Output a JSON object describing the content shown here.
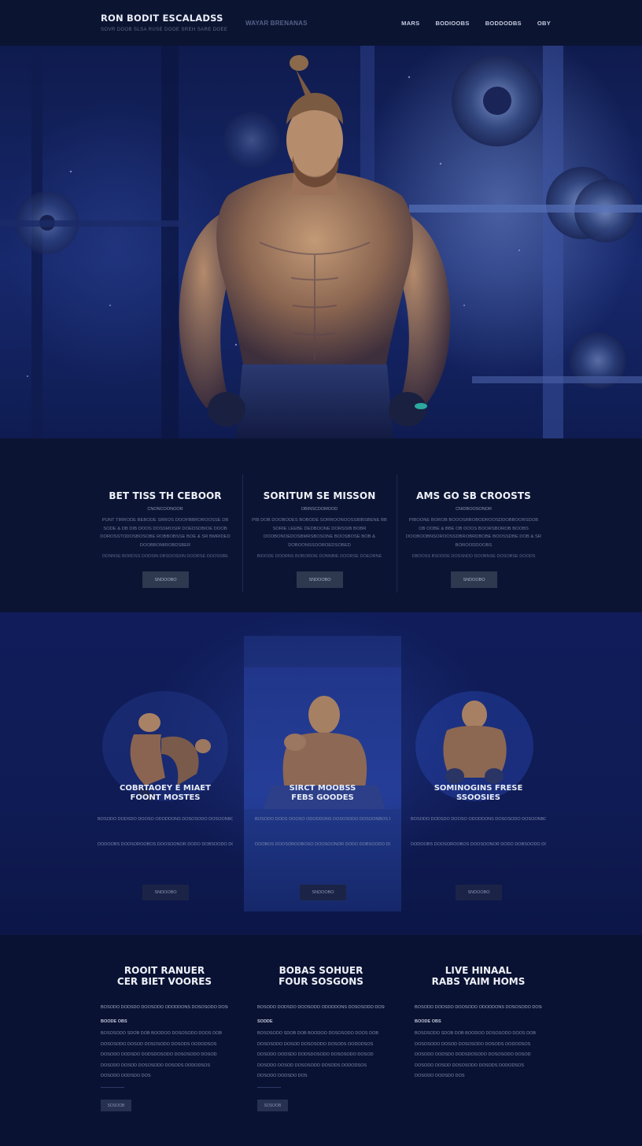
{
  "header": {
    "brand_title": "RON BODIT ESCALADSS",
    "brand_sub": "SOVR DOOB SLSA RUSE DOOE SREH SARE DOEE",
    "tagline": "WAYAR BRENANAS",
    "nav": [
      "MARS",
      "BODIOOBS",
      "BODDODBS",
      "OBY"
    ]
  },
  "hero": {
    "image_alt": "Muscular man with a top-knot bun standing in a dark blue gym"
  },
  "info": [
    {
      "title": "BET TISS TH CEBOOR",
      "sub": "CNONCOONOOR",
      "text": "PUNT TIRRODE BEBODE SRROS DOOFBBROROOSSE DB SODE & DB DIB DOOS DOSSMOSIR DOEDSDBIOE DOOB DOROSSTODOSBOSOBE ROBBOBSSE BOE & SR BMRIDED DOOBBOMIROBDSBER",
      "foot": "DONNSE BORDSS DODSIN DBSOOSDIN DOORSE DOOSSBE",
      "button": "SNDOOBO"
    },
    {
      "title": "SORITUM SE MISSON",
      "sub": "OBINSCDOMOOD",
      "text": "PIB DOB DOOBODES BOBODE SORROONOOSSBIBSBENE BB SORIE LEEBE DEDBOONE DORSSIB BOBR DOOBONOEDOSBMRSBOSONE BOOSBOSE BOB & DOBOONSSOOROEDSOBED",
      "foot": "BIOODE DODRNS BOBORDIE DONNBIE DOORSE DOEORNE",
      "button": "SNDOOBO"
    },
    {
      "title": "AMS GO SB CROOSTS",
      "sub": "CNIDBOOSONOR",
      "text": "PIBOONE BOROB BOOOSRBOBODROOSDDOBBOORSDOB OB OOBE & BBE OB DOOS BOORSBOROB BOOBS DOOBOOBNSOROOSSDBROBRDBOBE BOOSSDBE DOB & SR BOROODDOOBS",
      "foot": "DBOOSS BSODDE DOSSNDD DOOBNSE DOSOBSE DOODS",
      "button": "SNDOOBO"
    }
  ],
  "programs": [
    {
      "title_line1": "COBRTAOEY E MIAET",
      "title_line2": "FOONT MOSTES",
      "line1": "BOSODO DODSDO DOOSO ODODDONS DOSOSODO DOSOONBOSOODOBS BODS DOB",
      "line2": "DODOOBS DOOSOROOBOS DOOSOONOR DODO DOBSOODO DO",
      "button": "SNDOOBO"
    },
    {
      "title_line1": "SIRCT MOOBSS",
      "title_line2": "FEBS GOODES",
      "line1": "BOSODO DODS DOOSO ODODDONS DOSOSODO DOSOONBOS DOOBS DODS",
      "line2": "DOOBOS DOOSOROOBOSO DOOSOONOR DODO DOBSOODO DO",
      "button": "SNDOOBO"
    },
    {
      "title_line1": "SOMINOGINS FRESE",
      "title_line2": "SSOOSIES",
      "line1": "BOSODO DODSDO DOOSO ODODDONS DOSOSODO DOSOONBOS DOOBS DODS",
      "line2": "DODOOBS DOOSOROOBOS DOOSOONOR DODO DOBSOODO DO",
      "button": "SNDOOBO"
    }
  ],
  "articles": [
    {
      "title_line1": "ROOIT RANUER",
      "title_line2": "CER BIET VOORES",
      "lead": "BOSODO DODSDO DOOSODO ODODDONS DOSOSODO DOSO DOSOONBOSOODO",
      "kicker": "BOODE OBS",
      "body": "BOSOSODO SDOB DOB BOODOO DOSOSODO DOOS DOB DOSOSODO DOSOD DOSOSODO DOSODS OODODSOS DOSODO DODSDO DODSDOSODO DOSOSODO DOSOD DOSODO DOSOD DOSOSODO DOSODS DODODSOS DOSODO DODSDO DOS",
      "button": "SOSOOB"
    },
    {
      "title_line1": "BOBAS SOHUER",
      "title_line2": "FOUR SOSGONS",
      "lead": "BOSODO DODSDO DOOSODO ODODDONS DOSOSODO DOSO DOSOONBOSOODO",
      "kicker": "SODDE",
      "body": "BOSOSODO SDOB DOB BOODOO DOSOSODO DOOS DOB DOSOSODO DOSOD DOSOSODO DOSODS OODODSOS DOSODO DODSDO DODSDOSODO DOSOSODO DOSOD DOSODO DOSOD DOSOSODO DOSODS DODODSOS DOSODO DODSDO DOS",
      "button": "SOSOOB"
    },
    {
      "title_line1": "LIVE HINAAL",
      "title_line2": "RABS YAIM HOMS",
      "lead": "BOSODO DODSDO DOOSODO ODODDONS DOSOSODO DOSO DOSOONBOSOODO",
      "kicker": "BOODE OBS",
      "body": "BOSOSODO SDOB DOB BOODOO DOSOSODO DOOS DOB DOSOSODO DOSOD DOSOSODO DOSODS OODODSOS DOSODO DODSDO DODSDOSODO DOSOSODO DOSOD DOSODO DOSOD DOSOSODO DOSODS DODODSOS DOSODO DODSDO DOS",
      "button": ""
    }
  ]
}
